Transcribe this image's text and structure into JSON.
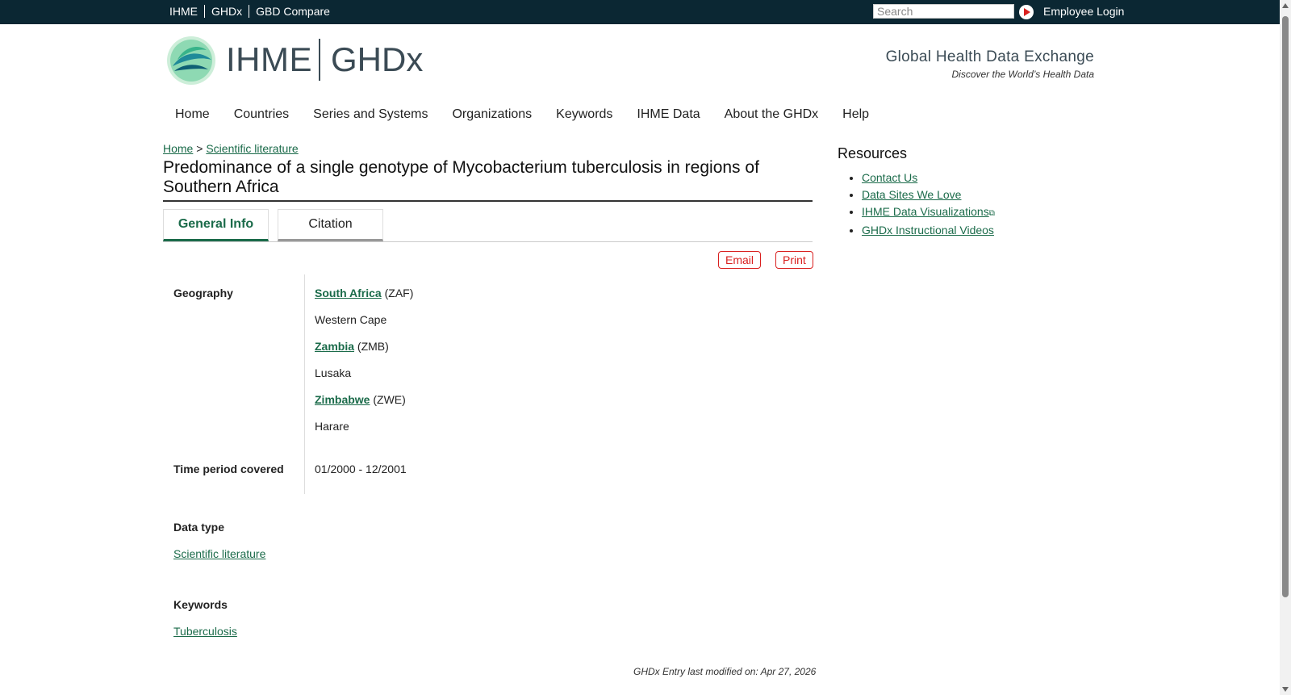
{
  "topbar": {
    "links": [
      "IHME",
      "GHDx",
      "GBD Compare"
    ],
    "search_placeholder": "Search",
    "login": "Employee Login"
  },
  "header": {
    "logo_left": "IHME",
    "logo_right": "GHDx",
    "tagline_title": "Global Health Data Exchange",
    "tagline_sub": "Discover the World’s Health Data"
  },
  "nav": {
    "items": [
      "Home",
      "Countries",
      "Series and Systems",
      "Organizations",
      "Keywords",
      "IHME Data",
      "About the GHDx",
      "Help"
    ]
  },
  "breadcrumb": {
    "home": "Home",
    "separator": ">",
    "current": "Scientific literature"
  },
  "page": {
    "title": "Predominance of a single genotype of Mycobacterium tuberculosis in regions of Southern Africa",
    "tabs": [
      "General Info",
      "Citation"
    ],
    "email": "Email",
    "print": "Print"
  },
  "details": {
    "geography_label": "Geography",
    "geo": [
      {
        "country": "South Africa",
        "code": "(ZAF)",
        "region": "Western Cape"
      },
      {
        "country": "Zambia",
        "code": "(ZMB)",
        "region": "Lusaka"
      },
      {
        "country": "Zimbabwe",
        "code": "(ZWE)",
        "region": "Harare"
      }
    ],
    "time_label": "Time period covered",
    "time_value": "01/2000 - 12/2001",
    "datatype_label": "Data type",
    "datatype_value": "Scientific literature",
    "keywords_label": "Keywords",
    "keywords_value": "Tuberculosis"
  },
  "footer": {
    "modified": "GHDx Entry last modified on: Apr 27, 2026"
  },
  "sidebar": {
    "title": "Resources",
    "links": [
      "Contact Us",
      "Data Sites We Love",
      "IHME Data Visualizations",
      "GHDx Instructional Videos"
    ]
  },
  "colors": {
    "topbar": "#0b2733",
    "link": "#1b6b4a",
    "accent_red": "#d9201f"
  }
}
